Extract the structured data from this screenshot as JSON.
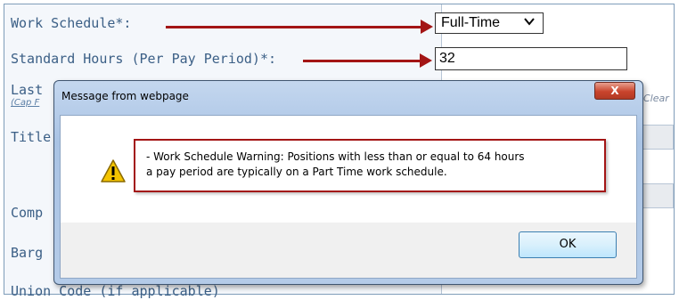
{
  "form": {
    "work_schedule_label": "Work Schedule*:",
    "work_schedule_value": "Full-Time",
    "standard_hours_label": "Standard Hours (Per Pay Period)*:",
    "standard_hours_value": "32",
    "last_label": "Last",
    "cap_label": "(Cap F",
    "title_label": "Title",
    "comp_label": "Comp",
    "barg_label": "Barg",
    "union_label": "Union Code (if applicable)",
    "clear_link": "Clear"
  },
  "dialog": {
    "title": "Message from webpage",
    "close_label": "X",
    "message_line1": "- Work Schedule Warning: Positions with less than or equal to 64 hours",
    "message_line2": "a pay period are typically on a Part Time work schedule.",
    "ok_label": "OK"
  },
  "colors": {
    "annotation_red": "#a31515",
    "label_blue": "#3b5f86"
  },
  "icons": {
    "warning": "warning-icon",
    "dropdown": "chevron-down-icon"
  }
}
